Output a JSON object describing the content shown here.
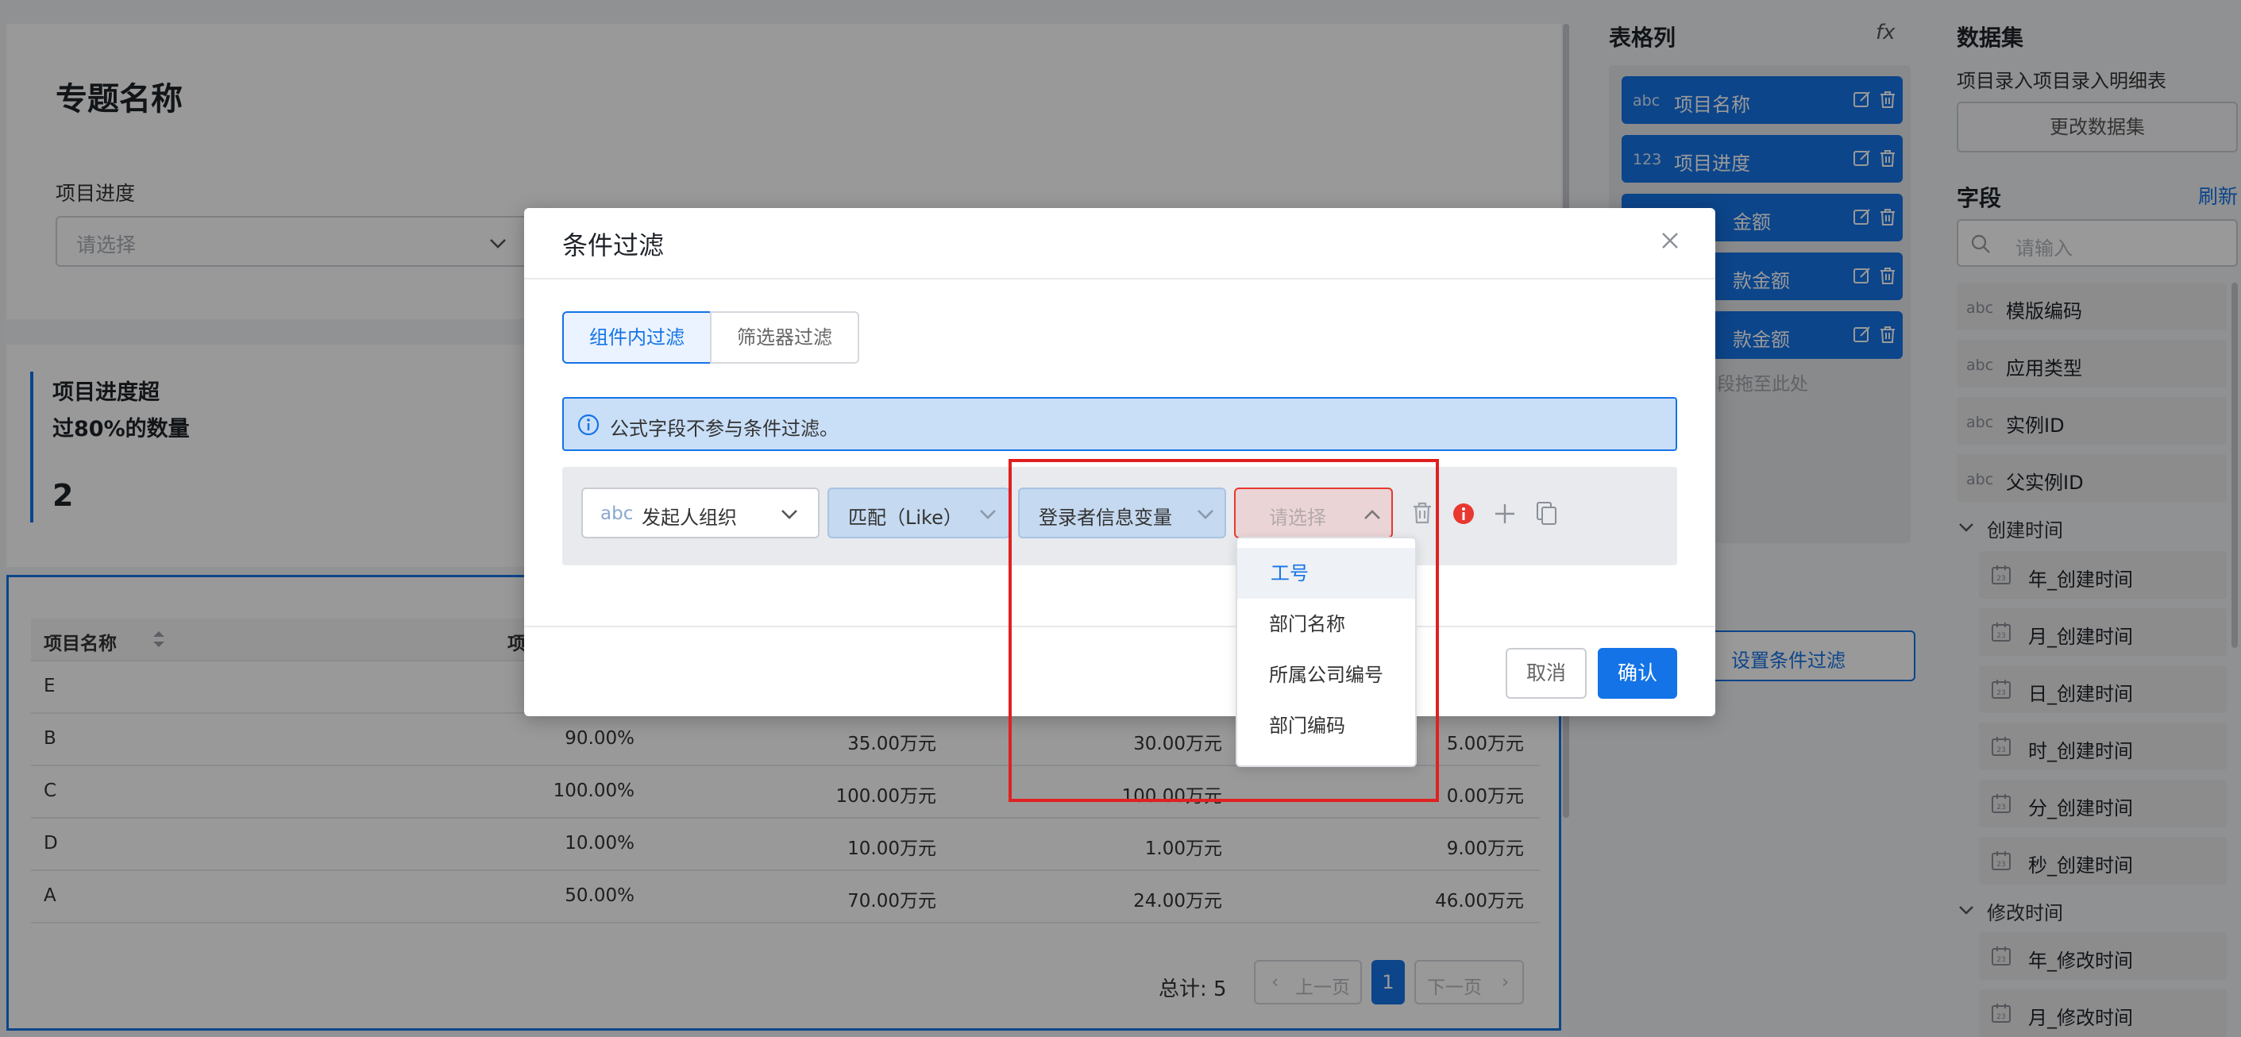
{
  "page": {
    "topic_title": "专题名称",
    "filter_label": "项目进度",
    "filter_placeholder": "请选择",
    "kpi": {
      "label_line1": "项目进度超",
      "label_line2": "过80%的数量",
      "value": "2"
    },
    "table": {
      "headers": [
        "项目名称",
        "项"
      ],
      "rows": [
        {
          "name": "E",
          "c1": "",
          "c2": "",
          "c3": "",
          "c4": ""
        },
        {
          "name": "B",
          "c1": "90.00%",
          "c2": "35.00万元",
          "c3": "30.00万元",
          "c4": "5.00万元"
        },
        {
          "name": "C",
          "c1": "100.00%",
          "c2": "100.00万元",
          "c3": "100.00万元",
          "c4": "0.00万元"
        },
        {
          "name": "D",
          "c1": "10.00%",
          "c2": "10.00万元",
          "c3": "1.00万元",
          "c4": "9.00万元"
        },
        {
          "name": "A",
          "c1": "50.00%",
          "c2": "70.00万元",
          "c3": "24.00万元",
          "c4": "46.00万元"
        }
      ],
      "total": "总计: 5",
      "prev": "上一页",
      "page": "1",
      "next": "下一页"
    }
  },
  "columns_panel": {
    "title": "表格列",
    "fx": "fx",
    "items": [
      {
        "type": "abc",
        "label": "项目名称"
      },
      {
        "type": "123",
        "label": "项目进度"
      },
      {
        "type": "",
        "label": "金额"
      },
      {
        "type": "",
        "label": "款金额"
      },
      {
        "type": "",
        "label": "款金额"
      }
    ],
    "drop_hint": "将字段拖至此处",
    "set_filter": "设置条件过滤"
  },
  "dataset_panel": {
    "title": "数据集",
    "dataset_name": "项目录入项目录入明细表",
    "change_btn": "更改数据集",
    "fields_title": "字段",
    "refresh": "刷新",
    "search_placeholder": "请输入",
    "fields": [
      {
        "type": "abc",
        "label": "模版编码"
      },
      {
        "type": "abc",
        "label": "应用类型"
      },
      {
        "type": "abc",
        "label": "实例ID"
      },
      {
        "type": "abc",
        "label": "父实例ID"
      }
    ],
    "group1": "创建时间",
    "group1_fields": [
      "年_创建时间",
      "月_创建时间",
      "日_创建时间",
      "时_创建时间",
      "分_创建时间",
      "秒_创建时间"
    ],
    "group2": "修改时间",
    "group2_fields": [
      "年_修改时间",
      "月_修改时间"
    ]
  },
  "modal": {
    "title": "条件过滤",
    "tabs": [
      "组件内过滤",
      "筛选器过滤"
    ],
    "info": "公式字段不参与条件过滤。",
    "condition": {
      "field_type": "abc",
      "field": "发起人组织",
      "operator": "匹配（Like）",
      "value_source": "登录者信息变量",
      "value_placeholder": "请选择"
    },
    "dropdown": [
      "工号",
      "部门名称",
      "所属公司编号",
      "部门编码"
    ],
    "cancel": "取消",
    "confirm": "确认"
  },
  "colors": {
    "primary": "#1473e6",
    "error": "#e8382f",
    "highlight": "#e02020"
  }
}
